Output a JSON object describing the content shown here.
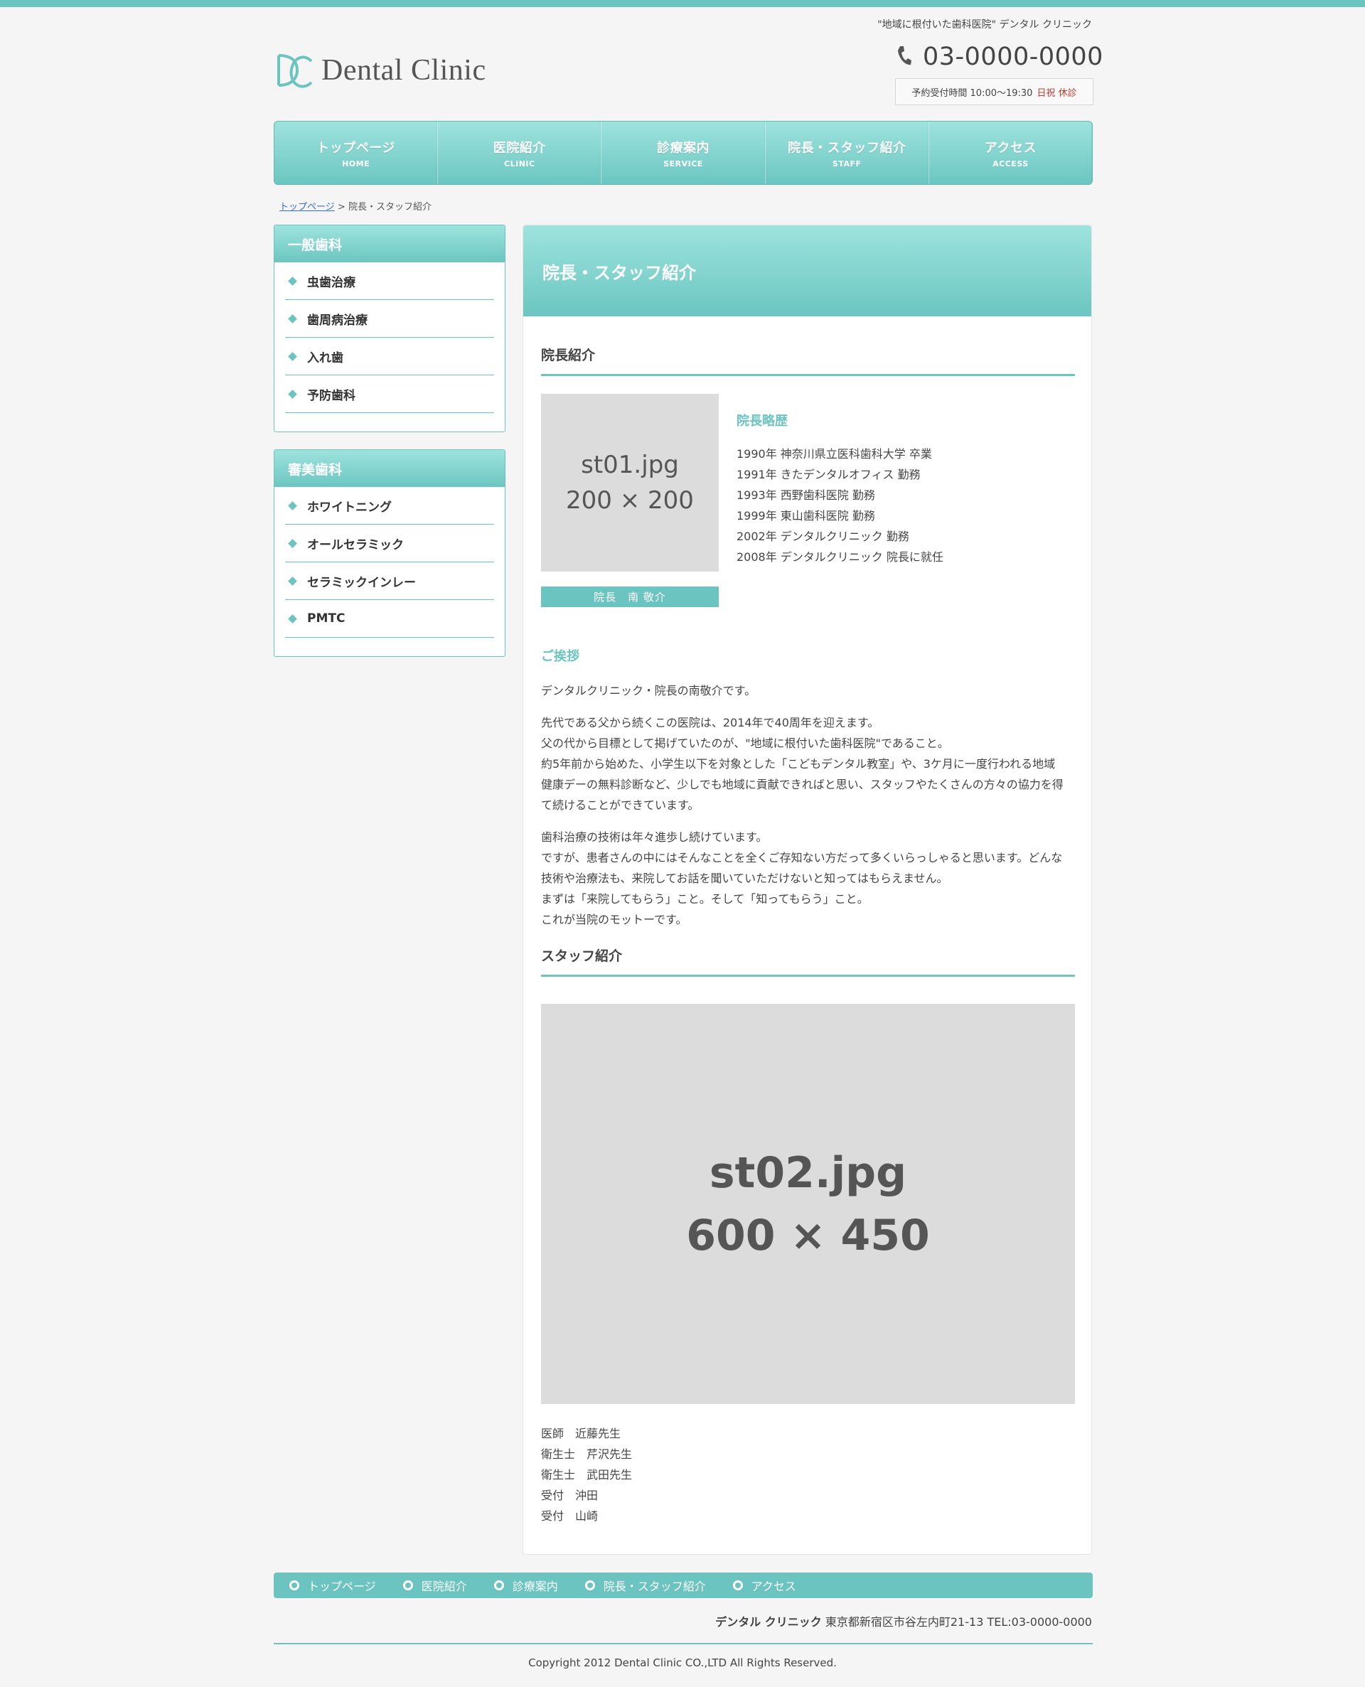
{
  "header": {
    "tagline": "\"地域に根付いた歯科医院\" デンタル クリニック",
    "logo_text": "Dental Clinic",
    "phone": "03-0000-0000",
    "hours_label": "予約受付時間 10:00～19:30",
    "hours_closed": "日祝 休診",
    "accent_color": "#6cc4c0"
  },
  "nav": [
    {
      "jp": "トップページ",
      "en": "HOME"
    },
    {
      "jp": "医院紹介",
      "en": "CLINIC"
    },
    {
      "jp": "診療案内",
      "en": "SERVICE"
    },
    {
      "jp": "院長・スタッフ紹介",
      "en": "STAFF"
    },
    {
      "jp": "アクセス",
      "en": "ACCESS"
    }
  ],
  "breadcrumb": {
    "home": "トップページ",
    "sep": ">",
    "current": "院長・スタッフ紹介"
  },
  "sidebar": [
    {
      "title": "一般歯科",
      "items": [
        "虫歯治療",
        "歯周病治療",
        "入れ歯",
        "予防歯科"
      ]
    },
    {
      "title": "審美歯科",
      "items": [
        "ホワイトニング",
        "オールセラミック",
        "セラミックインレー",
        "PMTC"
      ]
    }
  ],
  "main": {
    "title": "院長・スタッフ紹介",
    "director_heading": "院長紹介",
    "photo1": {
      "name": "st01.jpg",
      "size": "200 × 200"
    },
    "photo1_caption": "院長　南 敬介",
    "history_heading": "院長略歴",
    "history": [
      "1990年 神奈川県立医科歯科大学 卒業",
      "1991年 きたデンタルオフィス 勤務",
      "1993年 西野歯科医院 勤務",
      "1999年 東山歯科医院 勤務",
      "2002年 デンタルクリニック 勤務",
      "2008年 デンタルクリニック 院長に就任"
    ],
    "greeting_heading": "ご挨拶",
    "greeting_p1": [
      "デンタルクリニック・院長の南敬介です。"
    ],
    "greeting_p2": [
      "先代である父から続くこの医院は、2014年で40周年を迎えます。",
      "父の代から目標として掲げていたのが、\"地域に根付いた歯科医院\"であること。",
      "約5年前から始めた、小学生以下を対象とした「こどもデンタル教室」や、3ケ月に一度行われる地域",
      "健康デーの無料診断など、少しでも地域に貢献できればと思い、スタッフやたくさんの方々の協力を得",
      "て続けることができています。"
    ],
    "greeting_p3": [
      "歯科治療の技術は年々進歩し続けています。",
      "ですが、患者さんの中にはそんなことを全くご存知ない方だって多くいらっしゃると思います。どんな",
      "技術や治療法も、来院してお話を聞いていただけないと知ってはもらえません。",
      "まずは「来院してもらう」こと。そして「知ってもらう」こと。",
      "これが当院のモットーです。"
    ],
    "staff_heading": "スタッフ紹介",
    "photo2": {
      "name": "st02.jpg",
      "size": "600 × 450"
    },
    "staff": [
      "医師　近藤先生",
      "衛生士　芹沢先生",
      "衛生士　武田先生",
      "受付　沖田",
      "受付　山崎"
    ]
  },
  "footer": {
    "nav": [
      "トップページ",
      "医院紹介",
      "診療案内",
      "院長・スタッフ紹介",
      "アクセス"
    ],
    "clinic_name": "デンタル クリニック",
    "address": "東京都新宿区市谷左内町21-13 TEL:03-0000-0000",
    "copyright": "Copyright 2012 Dental Clinic CO.,LTD All Rights Reserved."
  }
}
